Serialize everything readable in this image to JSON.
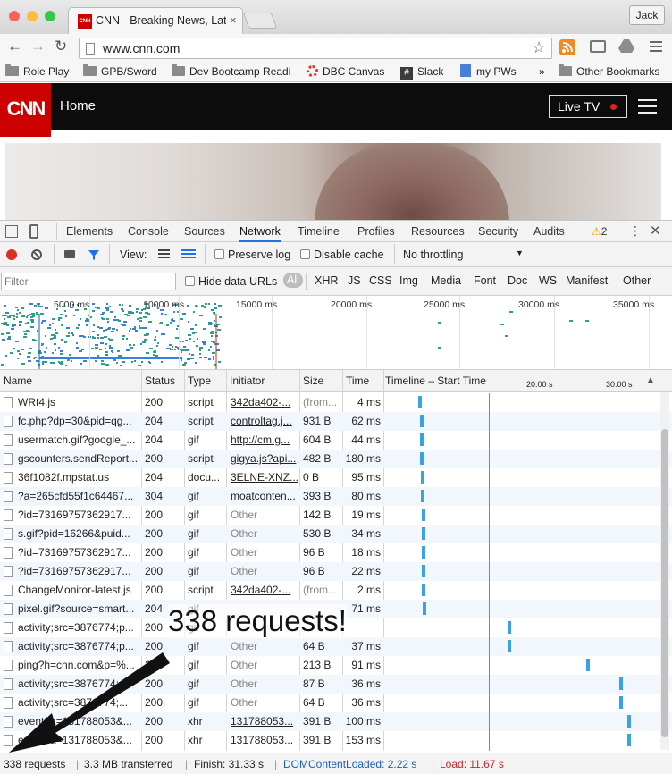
{
  "browser": {
    "tab_title": "CNN - Breaking News, Late",
    "favicon_text": "CNN",
    "tab_close": "×",
    "user_button": "Jack",
    "url": "www.cnn.com",
    "icons": [
      "back-icon",
      "forward-icon",
      "reload-icon",
      "page-icon",
      "star-icon",
      "rss-icon",
      "cast-icon",
      "drive-icon",
      "menu-icon"
    ],
    "bookmarks": [
      "Role Play",
      "GPB/Sword",
      "Dev Bootcamp Readi",
      "DBC Canvas",
      "Slack",
      "my PWs"
    ],
    "bookmarks_more": "»",
    "other_bookmarks": "Other Bookmarks"
  },
  "page": {
    "logo": "CNN",
    "nav_home": "Home",
    "live_tv": "Live TV"
  },
  "devtools": {
    "tabs": [
      "Elements",
      "Console",
      "Sources",
      "Network",
      "Timeline",
      "Profiles",
      "Resources",
      "Security",
      "Audits"
    ],
    "active_tab": "Network",
    "warning_count": "2",
    "toolbar": {
      "view": "View:",
      "preserve_log": "Preserve log",
      "disable_cache": "Disable cache",
      "throttling": "No throttling"
    },
    "filter": {
      "placeholder": "Filter",
      "hide_data_urls": "Hide data URLs",
      "types": [
        "All",
        "XHR",
        "JS",
        "CSS",
        "Img",
        "Media",
        "Font",
        "Doc",
        "WS",
        "Manifest",
        "Other"
      ]
    },
    "overview_ticks": [
      "5000 ms",
      "10000 ms",
      "15000 ms",
      "20000 ms",
      "25000 ms",
      "30000 ms",
      "35000 ms"
    ],
    "columns": {
      "name": "Name",
      "status": "Status",
      "type": "Type",
      "initiator": "Initiator",
      "size": "Size",
      "time": "Time",
      "timeline": "Timeline – Start Time",
      "t1": "20.00 s",
      "t2": "30.00 s"
    },
    "rows": [
      {
        "name": "WRf4.js",
        "status": "200",
        "type": "script",
        "initiator": "342da402-...",
        "init_link": true,
        "size": "(from...",
        "time": "4 ms",
        "start": 0.12
      },
      {
        "name": "fc.php?dp=30&pid=qg...",
        "status": "204",
        "type": "script",
        "initiator": "controltag.j...",
        "init_link": true,
        "size": "931 B",
        "time": "62 ms",
        "start": 0.125
      },
      {
        "name": "usermatch.gif?google_...",
        "status": "204",
        "type": "gif",
        "initiator": "http://cm.g...",
        "init_link": true,
        "size": "604 B",
        "time": "44 ms",
        "start": 0.125
      },
      {
        "name": "gscounters.sendReport...",
        "status": "200",
        "type": "script",
        "initiator": "gigya.js?api...",
        "init_link": true,
        "size": "482 B",
        "time": "180 ms",
        "start": 0.126
      },
      {
        "name": "36f1082f.mpstat.us",
        "status": "204",
        "type": "docu...",
        "initiator": "3ELNE-XNZ...",
        "init_link": true,
        "size": "0 B",
        "time": "95 ms",
        "start": 0.127
      },
      {
        "name": "?a=265cfd55f1c64467...",
        "status": "304",
        "type": "gif",
        "initiator": "moatconten...",
        "init_link": true,
        "size": "393 B",
        "time": "80 ms",
        "start": 0.128
      },
      {
        "name": "?id=73169757362917...",
        "status": "200",
        "type": "gif",
        "initiator": "Other",
        "init_link": false,
        "size": "142 B",
        "time": "19 ms",
        "start": 0.13
      },
      {
        "name": "s.gif?pid=16266&puid...",
        "status": "200",
        "type": "gif",
        "initiator": "Other",
        "init_link": false,
        "size": "530 B",
        "time": "34 ms",
        "start": 0.13
      },
      {
        "name": "?id=73169757362917...",
        "status": "200",
        "type": "gif",
        "initiator": "Other",
        "init_link": false,
        "size": "96 B",
        "time": "18 ms",
        "start": 0.131
      },
      {
        "name": "?id=73169757362917...",
        "status": "200",
        "type": "gif",
        "initiator": "Other",
        "init_link": false,
        "size": "96 B",
        "time": "22 ms",
        "start": 0.131
      },
      {
        "name": "ChangeMonitor-latest.js",
        "status": "200",
        "type": "script",
        "initiator": "342da402-...",
        "init_link": true,
        "size": "(from...",
        "time": "2 ms",
        "start": 0.131
      },
      {
        "name": "pixel.gif?source=smart...",
        "status": "204",
        "type": "gif",
        "initiator": "",
        "init_link": false,
        "size": "",
        "time": "71 ms",
        "start": 0.135
      },
      {
        "name": "activity;src=3876774;p...",
        "status": "200",
        "type": "gif",
        "initiator": "",
        "init_link": false,
        "size": "",
        "time": "",
        "start": 0.44
      },
      {
        "name": "activity;src=3876774;p...",
        "status": "200",
        "type": "gif",
        "initiator": "Other",
        "init_link": false,
        "size": "64 B",
        "time": "37 ms",
        "start": 0.44
      },
      {
        "name": "ping?h=cnn.com&p=%...",
        "status": "200",
        "type": "gif",
        "initiator": "Other",
        "init_link": false,
        "size": "213 B",
        "time": "91 ms",
        "start": 0.72
      },
      {
        "name": "activity;src=3876774;...",
        "status": "200",
        "type": "gif",
        "initiator": "Other",
        "init_link": false,
        "size": "87 B",
        "time": "36 ms",
        "start": 0.84
      },
      {
        "name": "activity;src=3876774;...",
        "status": "200",
        "type": "gif",
        "initiator": "Other",
        "init_link": false,
        "size": "64 B",
        "time": "36 ms",
        "start": 0.84
      },
      {
        "name": "event?a=131788053&...",
        "status": "200",
        "type": "xhr",
        "initiator": "131788053...",
        "init_link": true,
        "size": "391 B",
        "time": "100 ms",
        "start": 0.87
      },
      {
        "name": "event?a=131788053&...",
        "status": "200",
        "type": "xhr",
        "initiator": "131788053...",
        "init_link": true,
        "size": "391 B",
        "time": "153 ms",
        "start": 0.87
      }
    ],
    "status_bar": {
      "requests": "338 requests",
      "transferred": "3.3 MB transferred",
      "finish": "Finish: 31.33 s",
      "dom": "DOMContentLoaded: 2.22 s",
      "load": "Load: 11.67 s",
      "dom_color": "#1a5fb4",
      "load_color": "#c62828"
    }
  },
  "annotation": {
    "text": "338 requests!"
  }
}
